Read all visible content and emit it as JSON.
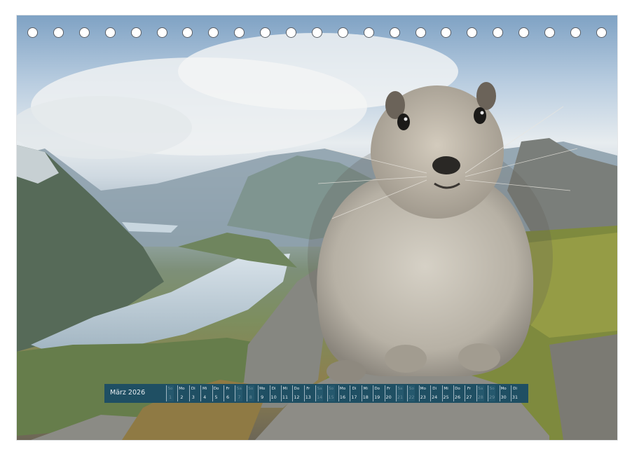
{
  "calendar": {
    "month_label": "März 2026",
    "days": [
      {
        "weekday": "So",
        "day": "1"
      },
      {
        "weekday": "Mo",
        "day": "2"
      },
      {
        "weekday": "Di",
        "day": "3"
      },
      {
        "weekday": "Mi",
        "day": "4"
      },
      {
        "weekday": "Do",
        "day": "5"
      },
      {
        "weekday": "Fr",
        "day": "6"
      },
      {
        "weekday": "Sa",
        "day": "7"
      },
      {
        "weekday": "So",
        "day": "8"
      },
      {
        "weekday": "Mo",
        "day": "9"
      },
      {
        "weekday": "Di",
        "day": "10"
      },
      {
        "weekday": "Mi",
        "day": "11"
      },
      {
        "weekday": "Do",
        "day": "12"
      },
      {
        "weekday": "Fr",
        "day": "13"
      },
      {
        "weekday": "Sa",
        "day": "14"
      },
      {
        "weekday": "So",
        "day": "15"
      },
      {
        "weekday": "Mo",
        "day": "16"
      },
      {
        "weekday": "Di",
        "day": "17"
      },
      {
        "weekday": "Mi",
        "day": "18"
      },
      {
        "weekday": "Do",
        "day": "19"
      },
      {
        "weekday": "Fr",
        "day": "20"
      },
      {
        "weekday": "Sa",
        "day": "21"
      },
      {
        "weekday": "So",
        "day": "22"
      },
      {
        "weekday": "Mo",
        "day": "23"
      },
      {
        "weekday": "Di",
        "day": "24"
      },
      {
        "weekday": "Mi",
        "day": "25"
      },
      {
        "weekday": "Do",
        "day": "26"
      },
      {
        "weekday": "Fr",
        "day": "27"
      },
      {
        "weekday": "Sa",
        "day": "28"
      },
      {
        "weekday": "So",
        "day": "29"
      },
      {
        "weekday": "Mo",
        "day": "30"
      },
      {
        "weekday": "Di",
        "day": "31"
      }
    ]
  },
  "colors": {
    "calendar_bar": "#1f4f63",
    "calendar_text": "#e8eef2"
  }
}
